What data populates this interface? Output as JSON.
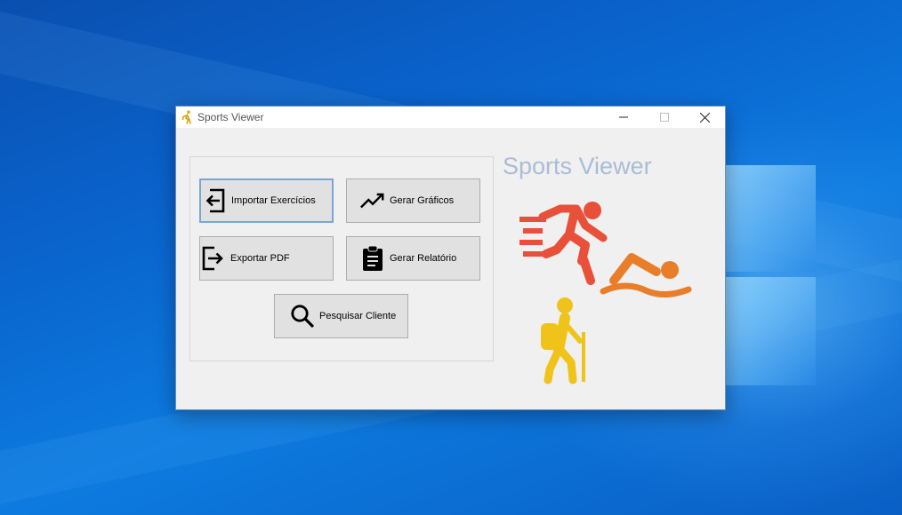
{
  "window": {
    "title": "Sports Viewer",
    "controls": {
      "minimize_icon": "minimize-icon",
      "maximize_icon": "maximize-icon",
      "close_icon": "close-icon"
    }
  },
  "main": {
    "heading": "Sports Viewer",
    "buttons": {
      "importar": "Importar Exercícios",
      "graficos": "Gerar Gráficos",
      "exportar": "Exportar PDF",
      "relatorio": "Gerar Relatório",
      "pesquisar": "Pesquisar Cliente"
    }
  },
  "icons": {
    "importar": "import-icon",
    "graficos": "trending-up-icon",
    "exportar": "export-icon",
    "relatorio": "clipboard-icon",
    "pesquisar": "search-icon",
    "runner": "running-icon",
    "swimmer": "swimming-icon",
    "hiker": "hiking-icon"
  },
  "colors": {
    "runner": "#e8503a",
    "swimmer": "#e87e2a",
    "hiker": "#f0c31a",
    "heading": "#a9bdd6",
    "desktop": "#0a66cf"
  }
}
